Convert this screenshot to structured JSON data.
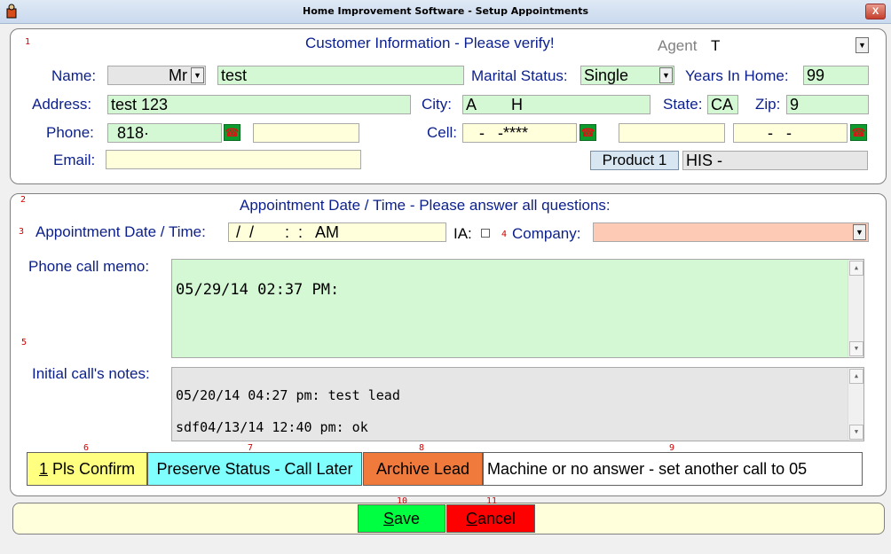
{
  "window": {
    "title": "Home Improvement Software - Setup Appointments",
    "close": "X"
  },
  "customer": {
    "heading": "Customer Information - Please verify!",
    "section_num": "1",
    "agent_label": "Agent",
    "agent_value": "T",
    "name_label": "Name:",
    "salutation": "Mr",
    "name_value": "test",
    "marital_label": "Marital Status:",
    "marital_value": "Single",
    "years_label": "Years In Home:",
    "years_value": "99",
    "address_label": "Address:",
    "address_value": "test 123",
    "city_label": "City:",
    "city_value": "A        H",
    "state_label": "State:",
    "state_value": "CA",
    "zip_label": "Zip:",
    "zip_value": "9",
    "phone_label": "Phone:",
    "phone_value": "818·",
    "phone2_value": "",
    "cell_label": "Cell:",
    "cell_value": "   -   -****",
    "cell2_value": "",
    "cell3_value": "       -   -",
    "email_label": "Email:",
    "email_value": "",
    "product_button": "Product 1",
    "product_value": "HIS -"
  },
  "appointment": {
    "heading": "Appointment Date / Time - Please answer all questions:",
    "section_num": "2",
    "date_num": "3",
    "date_label": "Appointment Date / Time:",
    "date_value": " /  /       :  :   AM",
    "ia_label": "IA:",
    "company_num": "4",
    "company_label": "Company:",
    "company_value": "",
    "memo_label": "Phone call memo:",
    "memo_num": "5",
    "memo_value": "05/29/14 02:37 PM:",
    "notes_label": "Initial call's notes:",
    "notes_lines": [
      "05/20/14 04:27 pm: test lead",
      "sdf04/13/14 12:40 pm: ok"
    ]
  },
  "actions": {
    "btn1_num": "6",
    "btn1_label_u": "1",
    "btn1_label": " Pls Confirm",
    "btn1_color": "#ffff80",
    "btn2_num": "7",
    "btn2_label": "Preserve Status - Call Later",
    "btn2_color": "#80ffff",
    "btn3_num": "8",
    "btn3_label": "Archive Lead",
    "btn3_color": "#f07a3c",
    "btn4_num": "9",
    "btn4_label": "Machine or no answer - set another call to 05",
    "btn4_color": "#ffffff"
  },
  "footer": {
    "save_num": "10",
    "save_u": "S",
    "save_label": "ave",
    "save_color": "#00ff40",
    "cancel_num": "11",
    "cancel_u": "C",
    "cancel_label": "ancel",
    "cancel_color": "#ff0000"
  }
}
